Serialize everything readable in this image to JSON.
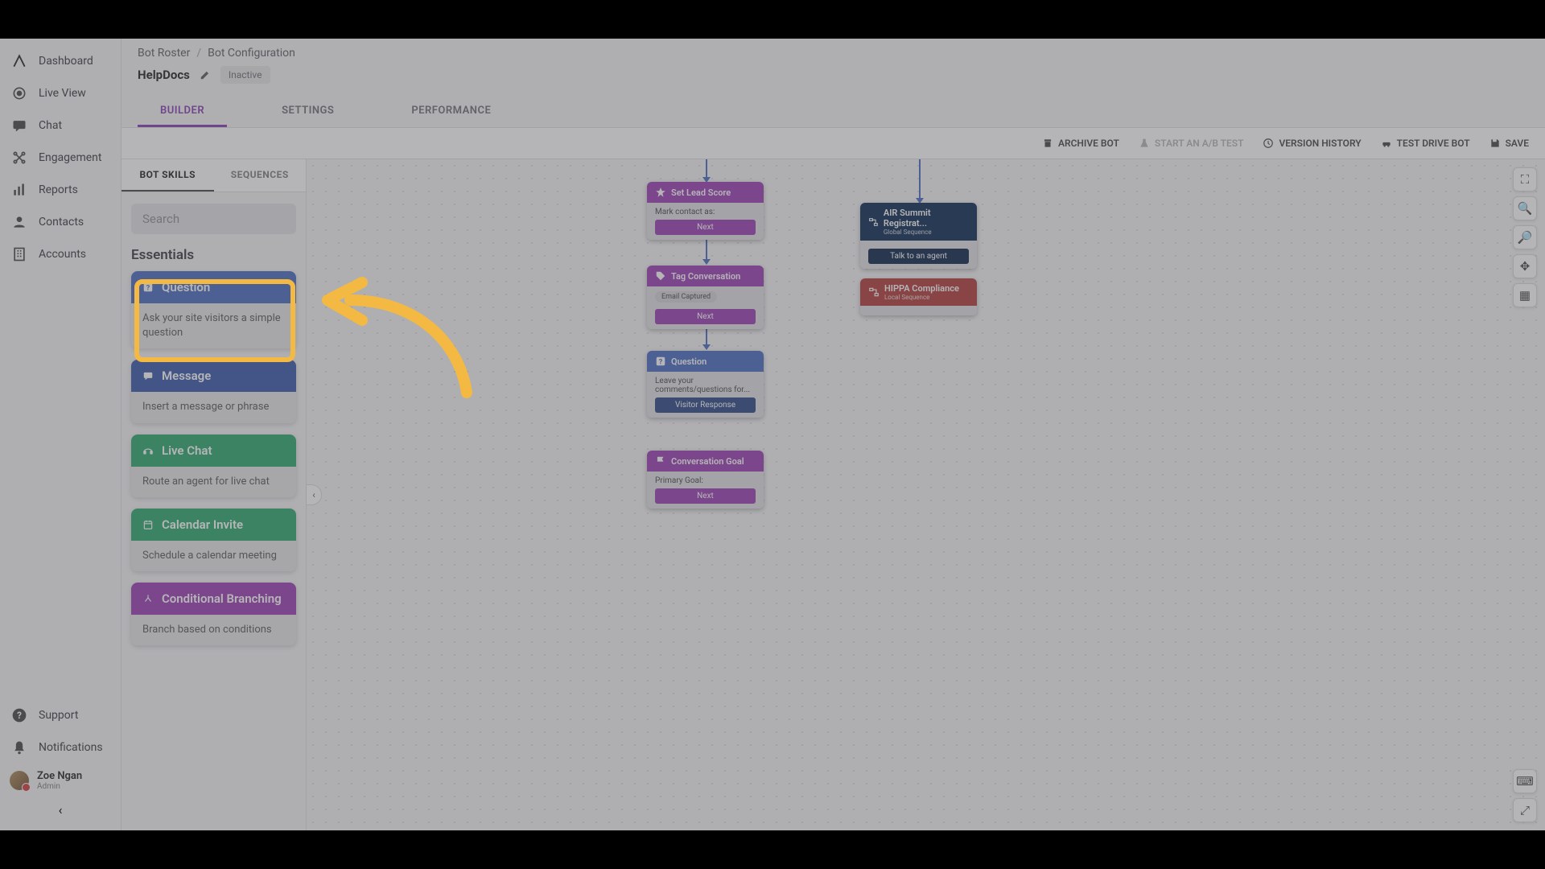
{
  "nav": {
    "items": [
      {
        "label": "Dashboard"
      },
      {
        "label": "Live View"
      },
      {
        "label": "Chat"
      },
      {
        "label": "Engagement"
      },
      {
        "label": "Reports"
      },
      {
        "label": "Contacts"
      },
      {
        "label": "Accounts"
      }
    ],
    "support": "Support",
    "notifications": "Notifications",
    "user_name": "Zoe Ngan",
    "user_role": "Admin"
  },
  "breadcrumb": {
    "root": "Bot Roster",
    "current": "Bot Configuration"
  },
  "bot": {
    "name": "HelpDocs",
    "status": "Inactive"
  },
  "main_tabs": {
    "builder": "BUILDER",
    "settings": "SETTINGS",
    "performance": "PERFORMANCE"
  },
  "toolbar": {
    "archive": "ARCHIVE BOT",
    "abtest": "START AN A/B TEST",
    "history": "VERSION HISTORY",
    "testdrive": "TEST DRIVE BOT",
    "save": "SAVE"
  },
  "skills_tabs": {
    "skills": "BOT SKILLS",
    "sequences": "SEQUENCES"
  },
  "search_placeholder": "Search",
  "section_title": "Essentials",
  "skills": {
    "question": {
      "title": "Question",
      "desc": "Ask your site visitors a simple question"
    },
    "message": {
      "title": "Message",
      "desc": "Insert a message or phrase"
    },
    "livechat": {
      "title": "Live Chat",
      "desc": "Route an agent for live chat"
    },
    "calendar": {
      "title": "Calendar Invite",
      "desc": "Schedule a calendar meeting"
    },
    "cond": {
      "title": "Conditional Branching",
      "desc": "Branch based on conditions"
    }
  },
  "nodes": {
    "leadscore": {
      "title": "Set Lead Score",
      "body": "Mark contact as:",
      "btn": "Next"
    },
    "tag": {
      "title": "Tag Conversation",
      "chip": "Email Captured",
      "btn": "Next"
    },
    "question": {
      "title": "Question",
      "body": "Leave your comments/questions for...",
      "btn": "Visitor Response"
    },
    "goal": {
      "title": "Conversation Goal",
      "body": "Primary Goal:",
      "btn": "Next"
    },
    "air": {
      "title": "AIR Summit Registrat...",
      "sub": "Global Sequence",
      "btn": "Talk to an agent"
    },
    "hippa": {
      "title": "HIPPA Compliance",
      "sub": "Local Sequence"
    }
  }
}
